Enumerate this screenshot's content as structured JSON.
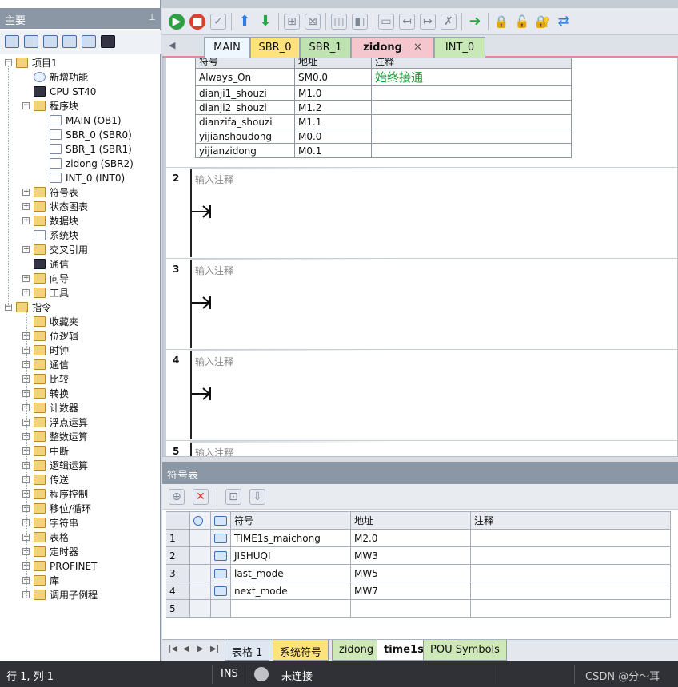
{
  "left_panel": {
    "title": "主要",
    "pin": "⊥",
    "tree": [
      {
        "label": "项目1",
        "indent": 0,
        "expander": "−",
        "icon": "project-icon"
      },
      {
        "label": "新增功能",
        "indent": 1,
        "icon": "help-icon"
      },
      {
        "label": "CPU ST40",
        "indent": 1,
        "icon": "cpu-icon"
      },
      {
        "label": "程序块",
        "indent": 1,
        "expander": "−",
        "icon": "folder-icon"
      },
      {
        "label": "MAIN (OB1)",
        "indent": 2,
        "icon": "block-icon"
      },
      {
        "label": "SBR_0 (SBR0)",
        "indent": 2,
        "icon": "block-icon"
      },
      {
        "label": "SBR_1 (SBR1)",
        "indent": 2,
        "icon": "block-icon"
      },
      {
        "label": "zidong (SBR2)",
        "indent": 2,
        "icon": "block-icon"
      },
      {
        "label": "INT_0 (INT0)",
        "indent": 2,
        "icon": "block-icon"
      },
      {
        "label": "符号表",
        "indent": 1,
        "expander": "+",
        "icon": "folder-icon"
      },
      {
        "label": "状态图表",
        "indent": 1,
        "expander": "+",
        "icon": "folder-icon"
      },
      {
        "label": "数据块",
        "indent": 1,
        "expander": "+",
        "icon": "folder-icon"
      },
      {
        "label": "系统块",
        "indent": 1,
        "icon": "system-block-icon"
      },
      {
        "label": "交叉引用",
        "indent": 1,
        "expander": "+",
        "icon": "folder-icon"
      },
      {
        "label": "通信",
        "indent": 1,
        "icon": "network-icon"
      },
      {
        "label": "向导",
        "indent": 1,
        "expander": "+",
        "icon": "wizard-icon"
      },
      {
        "label": "工具",
        "indent": 1,
        "expander": "+",
        "icon": "tools-icon"
      },
      {
        "label": "指令",
        "indent": 0,
        "expander": "−",
        "icon": "instructions-icon"
      },
      {
        "label": "收藏夹",
        "indent": 1,
        "icon": "favorites-icon"
      },
      {
        "label": "位逻辑",
        "indent": 1,
        "expander": "+",
        "icon": "folder-icon"
      },
      {
        "label": "时钟",
        "indent": 1,
        "expander": "+",
        "icon": "folder-icon"
      },
      {
        "label": "通信",
        "indent": 1,
        "expander": "+",
        "icon": "folder-icon"
      },
      {
        "label": "比较",
        "indent": 1,
        "expander": "+",
        "icon": "folder-icon"
      },
      {
        "label": "转换",
        "indent": 1,
        "expander": "+",
        "icon": "folder-icon"
      },
      {
        "label": "计数器",
        "indent": 1,
        "expander": "+",
        "icon": "folder-icon"
      },
      {
        "label": "浮点运算",
        "indent": 1,
        "expander": "+",
        "icon": "folder-icon"
      },
      {
        "label": "整数运算",
        "indent": 1,
        "expander": "+",
        "icon": "folder-icon"
      },
      {
        "label": "中断",
        "indent": 1,
        "expander": "+",
        "icon": "folder-icon"
      },
      {
        "label": "逻辑运算",
        "indent": 1,
        "expander": "+",
        "icon": "folder-icon"
      },
      {
        "label": "传送",
        "indent": 1,
        "expander": "+",
        "icon": "folder-icon"
      },
      {
        "label": "程序控制",
        "indent": 1,
        "expander": "+",
        "icon": "folder-icon"
      },
      {
        "label": "移位/循环",
        "indent": 1,
        "expander": "+",
        "icon": "folder-icon"
      },
      {
        "label": "字符串",
        "indent": 1,
        "expander": "+",
        "icon": "folder-icon"
      },
      {
        "label": "表格",
        "indent": 1,
        "expander": "+",
        "icon": "folder-icon"
      },
      {
        "label": "定时器",
        "indent": 1,
        "expander": "+",
        "icon": "folder-icon"
      },
      {
        "label": "PROFINET",
        "indent": 1,
        "expander": "+",
        "icon": "folder-icon"
      },
      {
        "label": "库",
        "indent": 1,
        "expander": "+",
        "icon": "folder-icon"
      },
      {
        "label": "调用子例程",
        "indent": 1,
        "expander": "+",
        "icon": "folder-icon"
      }
    ]
  },
  "editor_tabs": [
    {
      "label": "MAIN",
      "color": "#eef6ff"
    },
    {
      "label": "SBR_0",
      "color": "#ffe27a"
    },
    {
      "label": "SBR_1",
      "color": "#bfe3b0"
    },
    {
      "label": "zidong",
      "color": "#f6c6cf",
      "active": true,
      "close": "✕"
    },
    {
      "label": "INT_0",
      "color": "#c9e8b8"
    }
  ],
  "symbol_info": {
    "headers": [
      "符号",
      "地址",
      "注释"
    ],
    "rows": [
      {
        "symbol": "Always_On",
        "address": "SM0.0",
        "comment": "始终接通"
      },
      {
        "symbol": "dianji1_shouzi",
        "address": "M1.0",
        "comment": ""
      },
      {
        "symbol": "dianji2_shouzi",
        "address": "M1.2",
        "comment": ""
      },
      {
        "symbol": "dianzifa_shouzi",
        "address": "M1.1",
        "comment": ""
      },
      {
        "symbol": "yijianshoudong",
        "address": "M0.0",
        "comment": ""
      },
      {
        "symbol": "yijianzidong",
        "address": "M0.1",
        "comment": ""
      }
    ]
  },
  "networks": [
    {
      "num": "2",
      "comment": "输入注释"
    },
    {
      "num": "3",
      "comment": "输入注释"
    },
    {
      "num": "4",
      "comment": "输入注释"
    },
    {
      "num": "5",
      "comment": "输入注释"
    }
  ],
  "symbol_table": {
    "title": "符号表",
    "headers": [
      "符号",
      "地址",
      "注释"
    ],
    "rows": [
      {
        "n": "1",
        "symbol": "TIME1s_maichong",
        "address": "M2.0",
        "comment": ""
      },
      {
        "n": "2",
        "symbol": "JISHUQI",
        "address": "MW3",
        "comment": ""
      },
      {
        "n": "3",
        "symbol": "last_mode",
        "address": "MW5",
        "comment": ""
      },
      {
        "n": "4",
        "symbol": "next_mode",
        "address": "MW7",
        "comment": ""
      },
      {
        "n": "5",
        "symbol": "",
        "address": "",
        "comment": ""
      }
    ]
  },
  "bottom_tabs": [
    {
      "label": "表格 1",
      "color": "#dfe8f2"
    },
    {
      "label": "系统符号",
      "color": "#ffe27a"
    },
    {
      "label": "zidong",
      "color": "#cfe8b8"
    },
    {
      "label": "time1s",
      "color": "#ffffff",
      "active": true
    },
    {
      "label": "POU Symbols",
      "color": "#cfe8b8"
    }
  ],
  "status_bar": {
    "position": "行 1, 列 1",
    "mode": "INS",
    "connection": "未连接",
    "watermark": "CSDN @分～耳"
  }
}
